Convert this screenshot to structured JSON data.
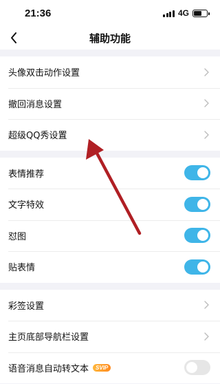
{
  "status_bar": {
    "time": "21:36",
    "network": "4G"
  },
  "nav": {
    "title": "辅助功能"
  },
  "groups": [
    {
      "rows": [
        {
          "label": "头像双击动作设置"
        },
        {
          "label": "撤回消息设置"
        },
        {
          "label": "超级QQ秀设置"
        }
      ]
    },
    {
      "rows": [
        {
          "label": "表情推荐",
          "toggle": "on"
        },
        {
          "label": "文字特效",
          "toggle": "on"
        },
        {
          "label": "怼图",
          "toggle": "on"
        },
        {
          "label": "贴表情",
          "toggle": "on"
        }
      ]
    },
    {
      "rows": [
        {
          "label": "彩签设置"
        },
        {
          "label": "主页底部导航栏设置"
        },
        {
          "label": "语音消息自动转文本",
          "badge": "SVIP",
          "toggle": "off"
        }
      ]
    }
  ],
  "colors": {
    "toggle_on": "#3fb5e8",
    "annotation_arrow": "#b01f24"
  }
}
